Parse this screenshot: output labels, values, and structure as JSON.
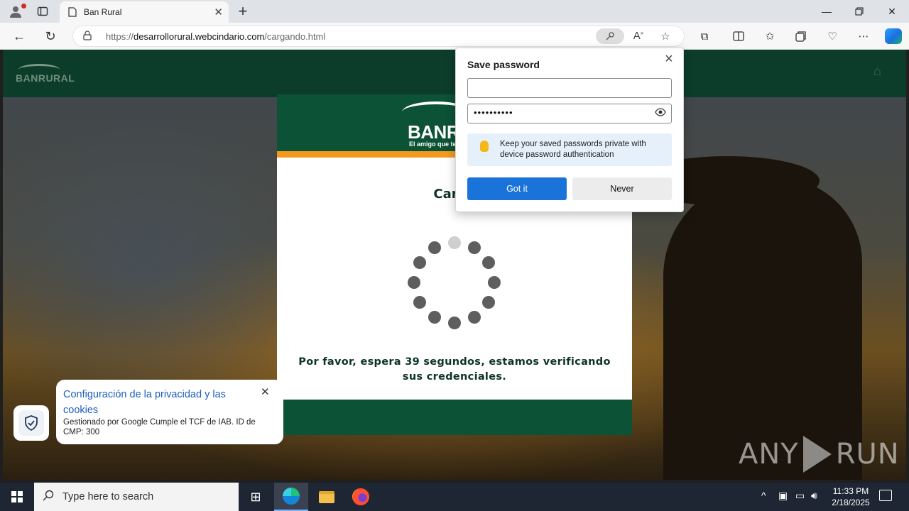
{
  "browser": {
    "tab_title": "Ban Rural",
    "url_domain": "desarrollorural.webcindario.com",
    "url_prefix": "https://",
    "url_path": "/cargando.html"
  },
  "page": {
    "card_title": "Carga",
    "logo_word": "BANRU",
    "logo_tagline": "El amigo que te",
    "message": "Por favor, espera 39 segundos, estamos verificando sus credenciales.",
    "header_logo_word": "BANRURAL"
  },
  "cookie": {
    "title": "Configuración de la privacidad y las cookies",
    "body": "Gestionado por Google Cumple el TCF de IAB. ID de CMP: 300"
  },
  "password_popup": {
    "title": "Save password",
    "username_value": "",
    "password_value": "••••••••••",
    "tip": "Keep your saved passwords private with device password authentication",
    "got_it_label": "Got it",
    "never_label": "Never"
  },
  "watermark": {
    "left": "ANY",
    "right": "RUN"
  },
  "taskbar": {
    "search_placeholder": "Type here to search",
    "time": "11:33 PM",
    "date": "2/18/2025"
  },
  "icons": {
    "profile": "profile-icon",
    "tab_actions": "tab-actions-icon",
    "page": "page-icon",
    "lock": "lock-icon",
    "key": "key-icon",
    "read_aloud": "read-aloud-icon",
    "favorite": "star-icon",
    "extensions": "puzzle-icon",
    "split": "split-screen-icon",
    "favorites": "favorites-icon",
    "collections": "collections-icon",
    "performance": "heart-pulse-icon",
    "more": "more-icon",
    "copilot": "copilot-icon"
  },
  "colors": {
    "brand_green": "#0c5236",
    "brand_orange": "#f39a1e",
    "button_blue": "#1a73d9"
  }
}
